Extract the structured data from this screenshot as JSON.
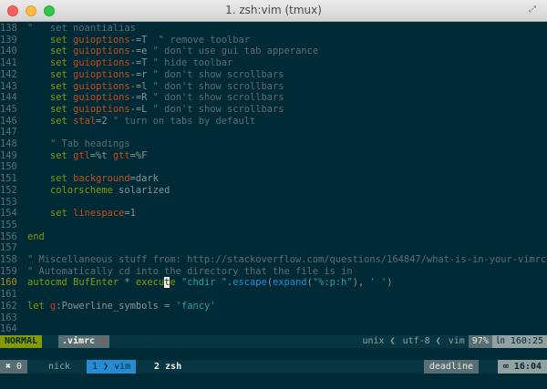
{
  "window": {
    "title": "1. zsh:vim (tmux)",
    "fullscreen_icon": "fullscreen-icon"
  },
  "lines": [
    {
      "num": "138",
      "segs": [
        {
          "t": "\"   set noantialias",
          "c": "c"
        }
      ]
    },
    {
      "num": "139",
      "segs": [
        {
          "t": "    ",
          "c": ""
        },
        {
          "t": "set",
          "c": "k"
        },
        {
          "t": " ",
          "c": ""
        },
        {
          "t": "guioptions",
          "c": "o"
        },
        {
          "t": "-=T  ",
          "c": ""
        },
        {
          "t": "\" remove toolbar",
          "c": "c"
        }
      ]
    },
    {
      "num": "140",
      "segs": [
        {
          "t": "    ",
          "c": ""
        },
        {
          "t": "set",
          "c": "k"
        },
        {
          "t": " ",
          "c": ""
        },
        {
          "t": "guioptions",
          "c": "o"
        },
        {
          "t": "-=e ",
          "c": ""
        },
        {
          "t": "\" don't use gui tab apperance",
          "c": "c"
        }
      ]
    },
    {
      "num": "141",
      "segs": [
        {
          "t": "    ",
          "c": ""
        },
        {
          "t": "set",
          "c": "k"
        },
        {
          "t": " ",
          "c": ""
        },
        {
          "t": "guioptions",
          "c": "o"
        },
        {
          "t": "-=T ",
          "c": ""
        },
        {
          "t": "\" hide toolbar",
          "c": "c"
        }
      ]
    },
    {
      "num": "142",
      "segs": [
        {
          "t": "    ",
          "c": ""
        },
        {
          "t": "set",
          "c": "k"
        },
        {
          "t": " ",
          "c": ""
        },
        {
          "t": "guioptions",
          "c": "o"
        },
        {
          "t": "-=r ",
          "c": ""
        },
        {
          "t": "\" don't show scrollbars",
          "c": "c"
        }
      ]
    },
    {
      "num": "143",
      "segs": [
        {
          "t": "    ",
          "c": ""
        },
        {
          "t": "set",
          "c": "k"
        },
        {
          "t": " ",
          "c": ""
        },
        {
          "t": "guioptions",
          "c": "o"
        },
        {
          "t": "-=l ",
          "c": ""
        },
        {
          "t": "\" don't show scrollbars",
          "c": "c"
        }
      ]
    },
    {
      "num": "144",
      "segs": [
        {
          "t": "    ",
          "c": ""
        },
        {
          "t": "set",
          "c": "k"
        },
        {
          "t": " ",
          "c": ""
        },
        {
          "t": "guioptions",
          "c": "o"
        },
        {
          "t": "-=R ",
          "c": ""
        },
        {
          "t": "\" don't show scrollbars",
          "c": "c"
        }
      ]
    },
    {
      "num": "145",
      "segs": [
        {
          "t": "    ",
          "c": ""
        },
        {
          "t": "set",
          "c": "k"
        },
        {
          "t": " ",
          "c": ""
        },
        {
          "t": "guioptions",
          "c": "o"
        },
        {
          "t": "-=L ",
          "c": ""
        },
        {
          "t": "\" don't show scrollbars",
          "c": "c"
        }
      ]
    },
    {
      "num": "146",
      "segs": [
        {
          "t": "    ",
          "c": ""
        },
        {
          "t": "set",
          "c": "k"
        },
        {
          "t": " ",
          "c": ""
        },
        {
          "t": "stal",
          "c": "o"
        },
        {
          "t": "=2 ",
          "c": ""
        },
        {
          "t": "\" turn on tabs by default",
          "c": "c"
        }
      ]
    },
    {
      "num": "147",
      "segs": []
    },
    {
      "num": "148",
      "segs": [
        {
          "t": "    ",
          "c": ""
        },
        {
          "t": "\" Tab headings",
          "c": "c"
        }
      ]
    },
    {
      "num": "149",
      "segs": [
        {
          "t": "    ",
          "c": ""
        },
        {
          "t": "set",
          "c": "k"
        },
        {
          "t": " ",
          "c": ""
        },
        {
          "t": "gtl",
          "c": "o"
        },
        {
          "t": "=%t ",
          "c": ""
        },
        {
          "t": "gtt",
          "c": "o"
        },
        {
          "t": "=%F",
          "c": ""
        }
      ]
    },
    {
      "num": "150",
      "segs": []
    },
    {
      "num": "151",
      "segs": [
        {
          "t": "    ",
          "c": ""
        },
        {
          "t": "set",
          "c": "k"
        },
        {
          "t": " ",
          "c": ""
        },
        {
          "t": "background",
          "c": "o"
        },
        {
          "t": "=dark",
          "c": ""
        }
      ]
    },
    {
      "num": "152",
      "segs": [
        {
          "t": "    ",
          "c": ""
        },
        {
          "t": "colorscheme",
          "c": "k"
        },
        {
          "t": " solarized",
          "c": ""
        }
      ]
    },
    {
      "num": "153",
      "segs": []
    },
    {
      "num": "154",
      "segs": [
        {
          "t": "    ",
          "c": ""
        },
        {
          "t": "set",
          "c": "k"
        },
        {
          "t": " ",
          "c": ""
        },
        {
          "t": "linespace",
          "c": "o"
        },
        {
          "t": "=1",
          "c": ""
        }
      ]
    },
    {
      "num": "155",
      "segs": []
    },
    {
      "num": "156",
      "segs": [
        {
          "t": "end",
          "c": "k"
        }
      ]
    },
    {
      "num": "157",
      "segs": []
    },
    {
      "num": "158",
      "segs": [
        {
          "t": "\" Miscellaneous stuff from: http://stackoverflow.com/questions/164847/what-is-in-your-vimrc",
          "c": "c"
        }
      ]
    },
    {
      "num": "159",
      "segs": [
        {
          "t": "\" Automatically cd into the directory that the file is in",
          "c": "c"
        }
      ]
    },
    {
      "num": "160",
      "cur": true,
      "segs": [
        {
          "t": "autocmd",
          "c": "k"
        },
        {
          "t": " ",
          "c": ""
        },
        {
          "t": "BufEnter",
          "c": "k"
        },
        {
          "t": " * ",
          "c": ""
        },
        {
          "t": "execu",
          "c": "k"
        },
        {
          "t": "t",
          "c": "cursor"
        },
        {
          "t": "e",
          "c": "k"
        },
        {
          "t": " ",
          "c": ""
        },
        {
          "t": "\"chdir \"",
          "c": "s"
        },
        {
          "t": ".",
          "c": ""
        },
        {
          "t": "escape",
          "c": "f"
        },
        {
          "t": "(",
          "c": ""
        },
        {
          "t": "expand",
          "c": "f"
        },
        {
          "t": "(",
          "c": ""
        },
        {
          "t": "\"%:p:h\"",
          "c": "s"
        },
        {
          "t": "), ",
          "c": ""
        },
        {
          "t": "' '",
          "c": "s"
        },
        {
          "t": ")",
          "c": ""
        }
      ]
    },
    {
      "num": "161",
      "segs": []
    },
    {
      "num": "162",
      "segs": [
        {
          "t": "let",
          "c": "k"
        },
        {
          "t": " ",
          "c": ""
        },
        {
          "t": "g",
          "c": "v"
        },
        {
          "t": ":Powerline_symbols = ",
          "c": ""
        },
        {
          "t": "'fancy'",
          "c": "s"
        }
      ]
    },
    {
      "num": "163",
      "segs": []
    },
    {
      "num": "164",
      "segs": []
    }
  ],
  "statusline": {
    "mode": "NORMAL",
    "filename": " .vimrc",
    "modified": " +",
    "fileformat": "unix ❮",
    "encoding": "utf-8 ❮",
    "filetype": "vim",
    "percent": "97%",
    "position": "㏑ 160:25"
  },
  "tmux": {
    "status": "✖ 0",
    "user": "nick",
    "window1": "1 ❯ vim",
    "window2": "2 zsh",
    "deadline": "deadline",
    "clock": "∞ 16:04"
  }
}
